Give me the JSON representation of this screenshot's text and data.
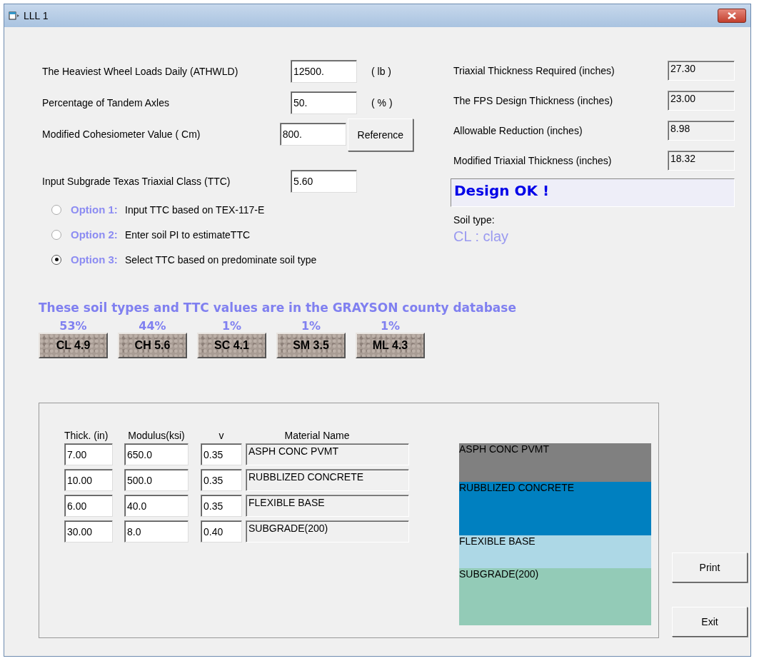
{
  "window": {
    "title": "LLL 1"
  },
  "inputs": [
    {
      "label": "The Heaviest Wheel Loads Daily  (ATHWLD)",
      "value": "12500.",
      "unit": "( lb )"
    },
    {
      "label": "Percentage of Tandem Axles",
      "value": "50.",
      "unit": "( % )"
    },
    {
      "label": "Modified  Cohesiometer   Value   ( Cm)",
      "value": "800.",
      "button": "Reference"
    }
  ],
  "ttc": {
    "label": "Input Subgrade Texas Triaxial Class    (TTC)",
    "value": "5.60"
  },
  "options": [
    {
      "tag": "Option 1:",
      "text": "Input TTC based on TEX-117-E",
      "selected": false
    },
    {
      "tag": "Option 2:",
      "text": "Enter soil PI to estimateTTC",
      "selected": false
    },
    {
      "tag": "Option 3:",
      "text": "Select TTC based on predominate soil type",
      "selected": true
    }
  ],
  "results": [
    {
      "label": "Triaxial Thickness Required  (inches)",
      "value": "27.30"
    },
    {
      "label": "The FPS Design Thickness   (inches)",
      "value": "23.00"
    },
    {
      "label": "Allowable Reduction (inches)",
      "value": "8.98"
    },
    {
      "label": "Modified Triaxial  Thickness   (inches)",
      "value": "18.32"
    }
  ],
  "status": "Design OK !",
  "soil": {
    "label": "Soil type:",
    "value": "CL : clay"
  },
  "database": {
    "heading": "These soil types and TTC values are in the GRAYSON county database",
    "soils": [
      {
        "percent": "53%",
        "button": "CL 4.9"
      },
      {
        "percent": "44%",
        "button": "CH 5.6"
      },
      {
        "percent": "1%",
        "button": "SC 4.1"
      },
      {
        "percent": "1%",
        "button": "SM 3.5"
      },
      {
        "percent": "1%",
        "button": "ML 4.3"
      }
    ]
  },
  "layers": {
    "columns": [
      "Thick. (in)",
      "Modulus(ksi)",
      "v",
      "Material Name"
    ],
    "rows": [
      {
        "thick": "7.00",
        "modulus": "650.0",
        "v": "0.35",
        "material": "ASPH CONC PVMT"
      },
      {
        "thick": "10.00",
        "modulus": "500.0",
        "v": "0.35",
        "material": "RUBBLIZED CONCRETE"
      },
      {
        "thick": "6.00",
        "modulus": "40.0",
        "v": "0.35",
        "material": "FLEXIBLE BASE"
      },
      {
        "thick": "30.00",
        "modulus": "8.0",
        "v": "0.40",
        "material": "SUBGRADE(200)"
      }
    ]
  },
  "profile": [
    {
      "label": "ASPH CONC PVMT",
      "color": "#808080"
    },
    {
      "label": "RUBBLIZED CONCRETE",
      "color": "#0080c0"
    },
    {
      "label": "FLEXIBLE BASE",
      "color": "#add8e6"
    },
    {
      "label": "SUBGRADE(200)",
      "color": "#93cbb7"
    }
  ],
  "buttons": [
    "Print",
    "Exit"
  ]
}
